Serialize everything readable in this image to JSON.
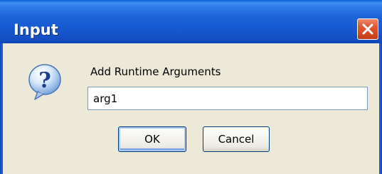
{
  "dialog": {
    "title": "Input",
    "prompt": "Add Runtime Arguments",
    "input_value": "arg1",
    "ok_label": "OK",
    "cancel_label": "Cancel",
    "icon": "question-icon"
  },
  "colors": {
    "titlebar": "#1656cf",
    "close_button": "#d34a22",
    "dialog_background": "#ece9d8",
    "input_border": "#7f9db9",
    "button_border": "#003c74"
  }
}
